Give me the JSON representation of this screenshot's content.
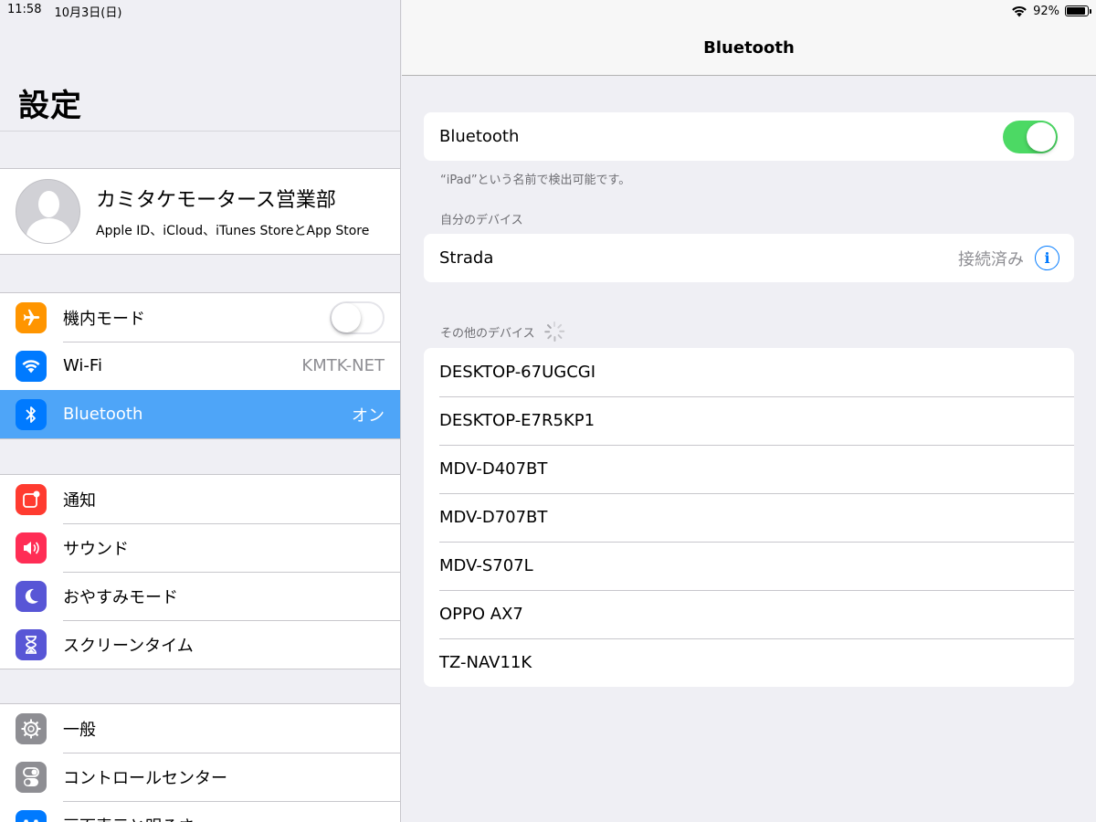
{
  "status_bar": {
    "time": "11:58",
    "date": "10月3日(日)",
    "battery": "92%",
    "battery_level": 0.92
  },
  "sidebar": {
    "title": "設定",
    "profile": {
      "name": "カミタケモータース営業部",
      "subtitle": "Apple ID、iCloud、iTunes StoreとApp Store"
    },
    "group1": [
      {
        "label": "機内モード",
        "icon": "airplane-icon",
        "color": "#ff9500",
        "toggle": "off"
      },
      {
        "label": "Wi-Fi",
        "icon": "wifi-icon",
        "color": "#007aff",
        "value": "KMTK-NET"
      },
      {
        "label": "Bluetooth",
        "icon": "bluetooth-icon",
        "color": "#007aff",
        "value": "オン",
        "selected": true
      }
    ],
    "group2": [
      {
        "label": "通知",
        "icon": "notifications-icon",
        "color": "#ff3b30"
      },
      {
        "label": "サウンド",
        "icon": "sound-icon",
        "color": "#ff2d55"
      },
      {
        "label": "おやすみモード",
        "icon": "moon-icon",
        "color": "#5856d6"
      },
      {
        "label": "スクリーンタイム",
        "icon": "hourglass-icon",
        "color": "#5856d6"
      }
    ],
    "group3": [
      {
        "label": "一般",
        "icon": "gear-icon",
        "color": "#8e8e93"
      },
      {
        "label": "コントロールセンター",
        "icon": "switches-icon",
        "color": "#8e8e93"
      },
      {
        "label": "画面表示と明るさ",
        "icon": "display-icon",
        "color": "#007aff"
      }
    ]
  },
  "detail": {
    "title": "Bluetooth",
    "bluetooth_row": {
      "label": "Bluetooth",
      "toggle": "on"
    },
    "discoverable_note": "“iPad”という名前で検出可能です。",
    "my_devices_header": "自分のデバイス",
    "my_devices": [
      {
        "name": "Strada",
        "status": "接続済み"
      }
    ],
    "other_devices_header": "その他のデバイス",
    "other_devices": [
      "DESKTOP-67UGCGI",
      "DESKTOP-E7R5KP1",
      "MDV-D407BT",
      "MDV-D707BT",
      "MDV-S707L",
      "OPPO AX7",
      "TZ-NAV11K"
    ]
  }
}
